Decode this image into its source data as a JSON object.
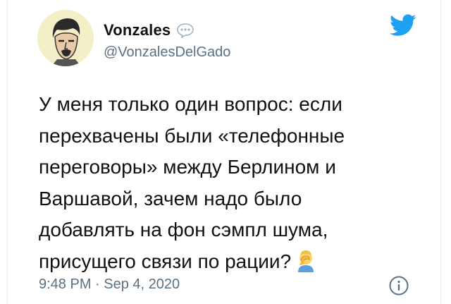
{
  "tweet": {
    "author": {
      "display_name": "Vonzales",
      "handle": "@VonzalesDelGado",
      "avatar_icon": "avatar-portrait-icon",
      "badge_icon": "speech-bubble-icon"
    },
    "text": "У меня только один вопрос: если\nперехвачены были «телефонные\nпереговоры» между Берлином и\nВаршавой, зачем надо было\nдобавлять на фон сэмпл шума,\nприсущего связи по рации?",
    "emoji_icon": "facepalm-emoji-icon",
    "timestamp": "9:48 PM · Sep 4, 2020",
    "platform_icon": "twitter-bird-icon",
    "info_icon": "info-icon",
    "colors": {
      "brand": "#1da1f2",
      "secondary_text": "#5b7083",
      "primary_text": "#111111"
    }
  }
}
